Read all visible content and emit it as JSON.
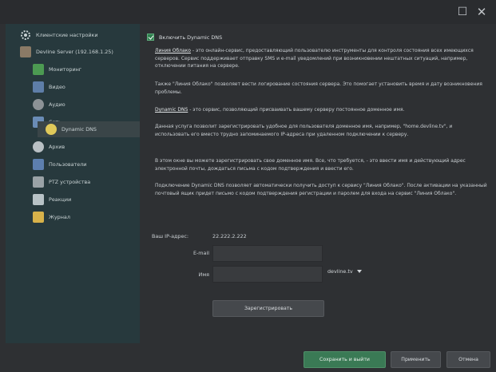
{
  "window": {
    "maximize_icon": "maximize-icon",
    "close_icon": "close-icon"
  },
  "sidebar": {
    "items": [
      {
        "label": "Клиентские настройки",
        "icon": "gear-icon"
      },
      {
        "label": "Devline Server (192.168.1.25)",
        "icon": "server-icon"
      },
      {
        "label": "Мониторинг",
        "icon": "monitoring-icon"
      },
      {
        "label": "Видео",
        "icon": "video-icon"
      },
      {
        "label": "Аудио",
        "icon": "audio-icon"
      },
      {
        "label": "Сеть",
        "icon": "network-icon"
      },
      {
        "label": "Dynamic DNS",
        "icon": "globe-icon"
      },
      {
        "label": "Архив",
        "icon": "archive-icon"
      },
      {
        "label": "Пользователи",
        "icon": "users-icon"
      },
      {
        "label": "PTZ устройства",
        "icon": "ptz-icon"
      },
      {
        "label": "Реакции",
        "icon": "reactions-icon"
      },
      {
        "label": "Журнал",
        "icon": "journal-icon"
      }
    ]
  },
  "content": {
    "enable_label": "Включить Dynamic DNS",
    "p1_link": "Линия Облако",
    "p1_text": " - это онлайн-сервис, предоставляющий пользователю инструменты для контроля состояния всех имеющихся серверов. Сервис поддерживает отправку SMS и e-mail уведомлений при возникновении нештатных ситуаций, например, отключении питания на сервере.",
    "p2": "Также \"Линия Облако\" позволяет вести логирование состояния сервера. Это помогает установить время и дату возникновения проблемы.",
    "p3_link": "Dynamic DNS",
    "p3_text": " - это сервис, позволяющий присваивать вашему серверу постоянное доменное имя.",
    "p4": "Данная услуга позволит зарегистрировать удобное для пользователя доменное имя, например, \"home.devline.tv\", и использовать его вместо трудно запоминаемого IP-адреса при удаленном подключении к серверу.",
    "p5": "В этом окне вы можете зарегистрировать свое доменное имя. Все, что требуется, - это ввести имя и действующий адрес электронной почты, дождаться письма с кодом подтверждения и ввести его.",
    "p6": "Подключение Dynamic DNS позволяет автоматически получить доступ к сервису \"Линия Облако\". После активации на указанный почтовый ящик придет письмо с кодом подтверждения регистрации и паролем для входа на сервис \"Линия Облако\".",
    "ip_label": "Ваш IP-адрес:",
    "ip_value": "22.222.2.222",
    "email_label": "E-mail",
    "email_value": "",
    "name_label": "Имя",
    "name_value": "",
    "domain_value": "devline.tv",
    "register_label": "Зарегистрировать"
  },
  "footer": {
    "save_label": "Сохранить и выйти",
    "apply_label": "Применить",
    "cancel_label": "Отмена"
  },
  "colors": {
    "sidebar_bg": "#27393d",
    "accent_green": "#3a7a55",
    "window_bg": "#2e3033"
  }
}
